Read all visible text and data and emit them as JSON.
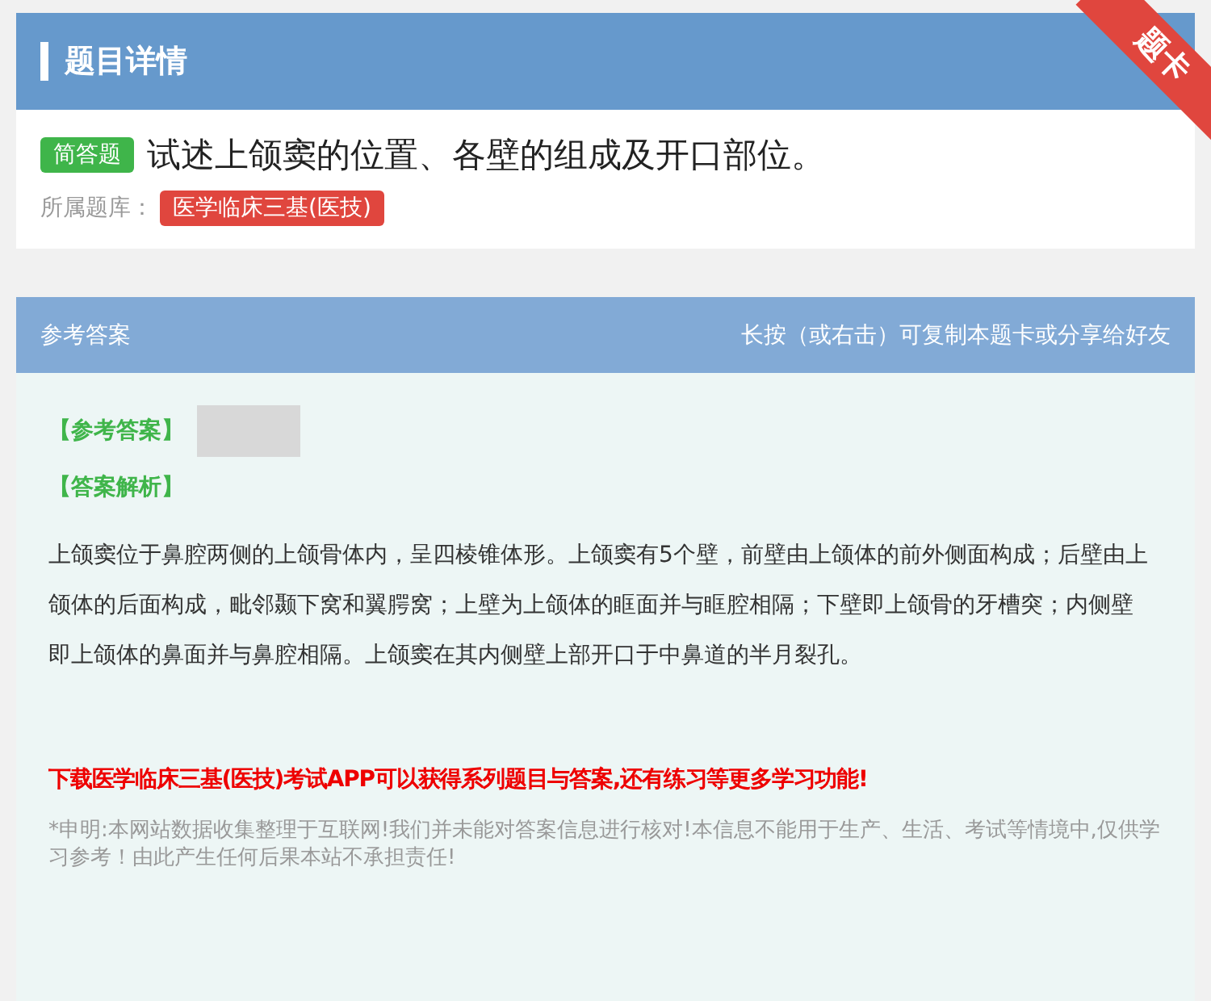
{
  "header": {
    "title": "题目详情",
    "ribbon": "题卡"
  },
  "question": {
    "type_tag": "简答题",
    "text": "试述上颌窦的位置、各壁的组成及开口部位。",
    "bank_label": "所属题库：",
    "bank_tag": "医学临床三基(医技)"
  },
  "answer_card": {
    "title": "参考答案",
    "hint": "长按（或右击）可复制本题卡或分享给好友",
    "answer_label": "【参考答案】",
    "analysis_label": "【答案解析】",
    "analysis": "上颌窦位于鼻腔两侧的上颌骨体内，呈四棱锥体形。上颌窦有5个壁，前壁由上颌体的前外侧面构成；后壁由上颌体的后面构成，毗邻颞下窝和翼腭窝；上壁为上颌体的眶面并与眶腔相隔；下壁即上颌骨的牙槽突；内侧壁即上颌体的鼻面并与鼻腔相隔。上颌窦在其内侧壁上部开口于中鼻道的半月裂孔。",
    "promo": "下载医学临床三基(医技)考试APP可以获得系列题目与答案,还有练习等更多学习功能!",
    "disclaimer": "*申明:本网站数据收集整理于互联网!我们并未能对答案信息进行核对!本信息不能用于生产、生活、考试等情境中,仅供学习参考！由此产生任何后果本站不承担责任!"
  }
}
